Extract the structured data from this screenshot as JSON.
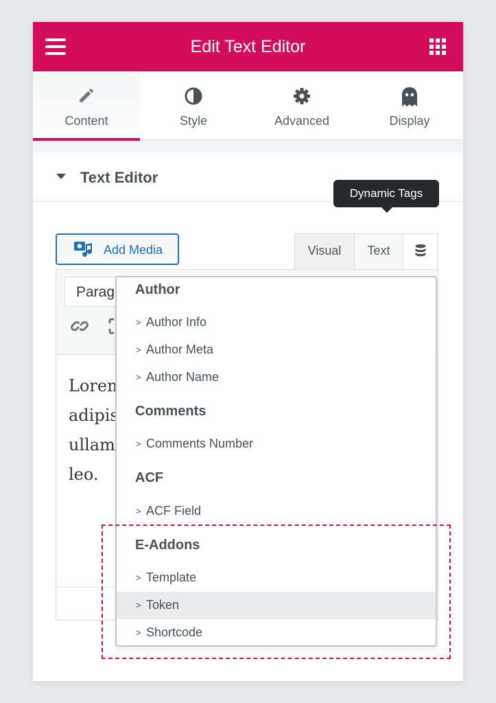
{
  "header": {
    "title": "Edit Text Editor",
    "accent_color": "#d30c5c"
  },
  "tabs": [
    {
      "label": "Content",
      "icon": "pencil-icon",
      "active": true
    },
    {
      "label": "Style",
      "icon": "half-circle-icon",
      "active": false
    },
    {
      "label": "Advanced",
      "icon": "gear-icon",
      "active": false
    },
    {
      "label": "Display",
      "icon": "ghost-icon",
      "active": false
    }
  ],
  "section": {
    "title": "Text Editor"
  },
  "media": {
    "add_media_label": "Add Media"
  },
  "editor_modes": {
    "visual": "Visual",
    "text": "Text",
    "dynamic_icon": "database-icon"
  },
  "tooltip": {
    "text": "Dynamic Tags"
  },
  "toolbar": {
    "format_value": "Paragraph"
  },
  "editor": {
    "content_lines": [
      "Lorem",
      "adipis",
      "ullam",
      "leo."
    ]
  },
  "dynamic_tags": {
    "groups": [
      {
        "title": "Author",
        "items": [
          "Author Info",
          "Author Meta",
          "Author Name"
        ]
      },
      {
        "title": "Comments",
        "items": [
          "Comments Number"
        ]
      },
      {
        "title": "ACF",
        "items": [
          "ACF Field"
        ]
      },
      {
        "title": "E-Addons",
        "items": [
          "Template",
          "Token",
          "Shortcode"
        ]
      }
    ],
    "arrow": ">",
    "highlighted_item": "Token"
  }
}
